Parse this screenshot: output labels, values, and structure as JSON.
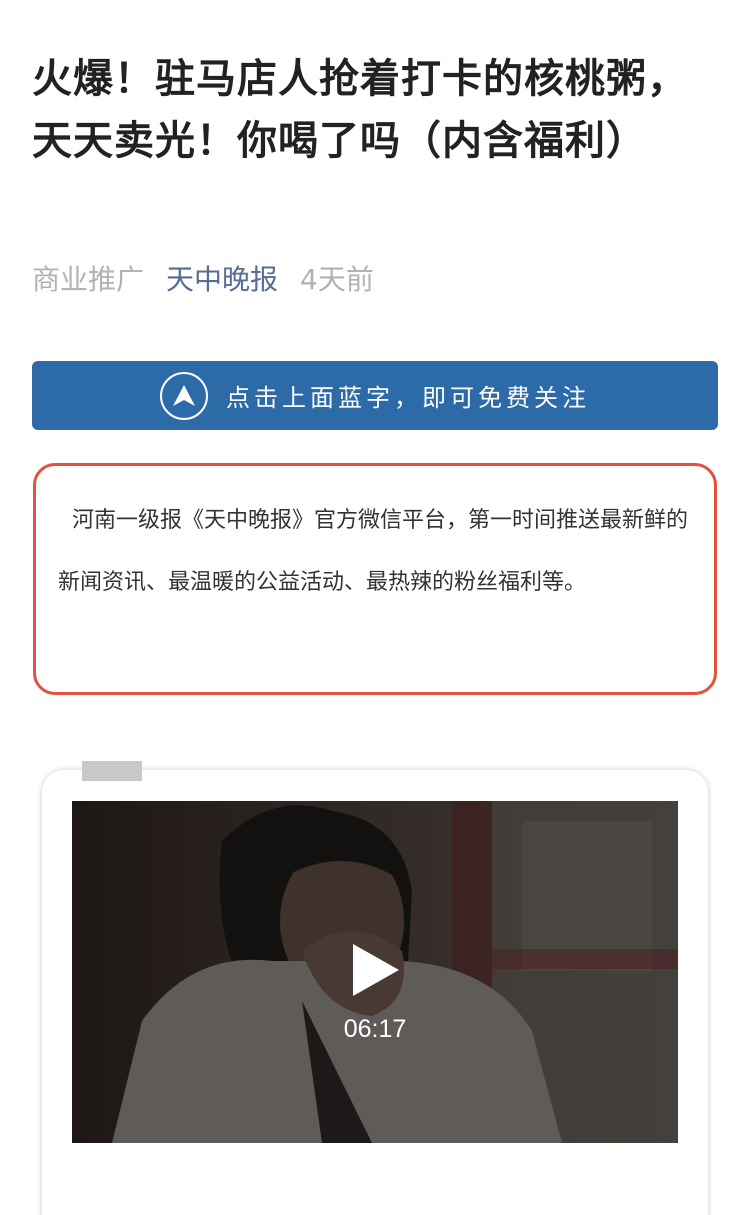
{
  "article": {
    "title": "火爆！驻马店人抢着打卡的核桃粥，天天卖光！你喝了吗（内含福利）",
    "meta": {
      "tag": "商业推广",
      "account": "天中晚报",
      "time": "4天前"
    }
  },
  "follow_banner": {
    "icon": "navigation-arrow-icon",
    "label": "点击上面蓝字，即可免费关注",
    "background": "#2d6aa8"
  },
  "intro": {
    "text": "河南一级报《天中晚报》官方微信平台，第一时间推送最新鲜的新闻资讯、最温暖的公益活动、最热辣的粉丝福利等。",
    "border_color": "#e0533e"
  },
  "video": {
    "duration": "06:17",
    "play_icon": "play-icon"
  }
}
